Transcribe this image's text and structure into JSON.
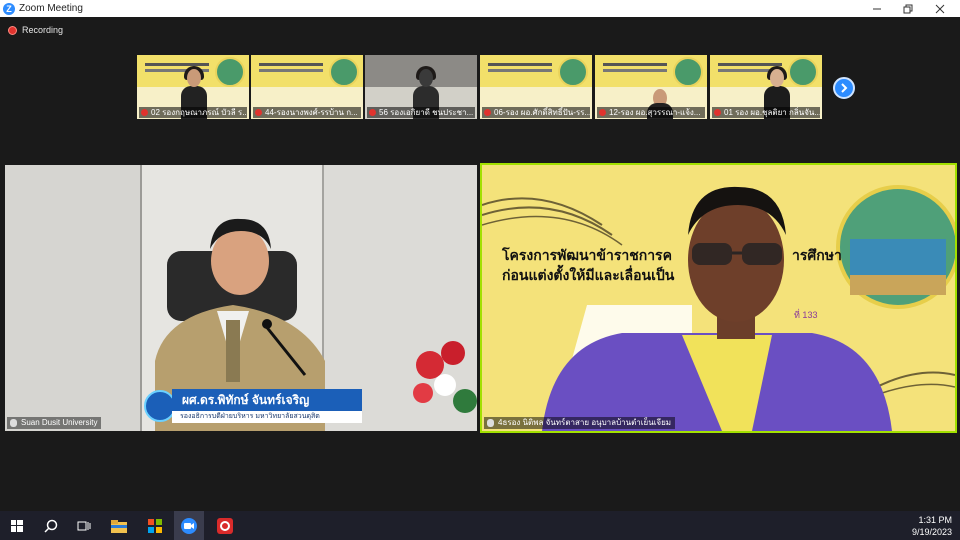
{
  "window": {
    "title": "Zoom Meeting",
    "controls": [
      "minimize",
      "maximize",
      "close"
    ]
  },
  "recording": {
    "label": "Recording"
  },
  "thumbnails": [
    {
      "name": "02 รองกฤษณาภรณ์ บัวลี ร..."
    },
    {
      "name": "44-รองนางพงศ์-รรบ้าน ก..."
    },
    {
      "name": "56 รองเอกิยาดี ชนประชา..."
    },
    {
      "name": "06-รอง ผอ.ศักดิ์สิทธิ์ปัน-รร..."
    },
    {
      "name": "12-รอง ผอ.สุวรรณา-แจ้ง..."
    },
    {
      "name": "01 รอง ผอ.ชุลติยา กลิ่นจัน..."
    }
  ],
  "main_tiles": {
    "left": {
      "name": "Suan Dusit University",
      "lower_third_name": "ผศ.ดร.พิทักษ์ จันทร์เจริญ",
      "lower_third_title": "รองอธิการบดีฝ่ายบริหาร มหาวิทยาลัยสวนดุสิต"
    },
    "right": {
      "name": "4ธรอง นิติพล จันทร์ตาสาย อนุบาลบ้านตำเย็นเจียม",
      "slide_line1": "โครงการพัฒนาข้าราชการค",
      "slide_line1_tail": "ารศึกษา",
      "slide_line2": "ก่อนแต่งตั้งให้มีและเลื่อนเป็น",
      "slide_line3": "ที่ 133"
    }
  },
  "taskbar": {
    "time": "1:31 PM",
    "date": "9/19/2023"
  },
  "colors": {
    "zoom_blue": "#2d8cff",
    "active_speaker_border": "#a2e000",
    "slide_yellow": "#f4e27a",
    "lower_third_blue": "#1b5fb8"
  }
}
